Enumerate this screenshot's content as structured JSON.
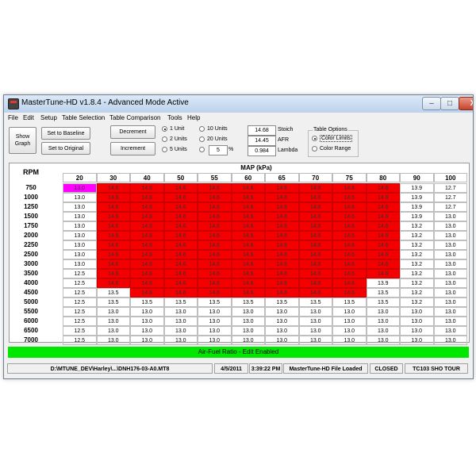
{
  "window": {
    "title": "MasterTune-HD  v1.8.4 - Advanced Mode Active",
    "controls": {
      "minimize": "–",
      "maximize": "□",
      "close": "X"
    }
  },
  "menu": [
    "File",
    "Edit",
    "Setup",
    "Table Selection",
    "Table Comparison",
    "Tools",
    "Help"
  ],
  "toolbar": {
    "show_graph_line1": "Show",
    "show_graph_line2": "Graph",
    "set_baseline": "Set to Baseline",
    "set_original": "Set to Original",
    "decrement": "Decrement",
    "increment": "Increment",
    "radios": {
      "one_unit": "1 Unit",
      "two_units": "2 Units",
      "five_units": "5 Units",
      "ten_units": "10 Units",
      "twenty_units": "20 Units"
    },
    "selected_unit": "1 Unit",
    "percent_value": "5",
    "percent_symbol": "%",
    "stoich_value": "14.68",
    "stoich_label": "Stoich",
    "afr_value": "14.45",
    "afr_label": "AFR",
    "lambda_value": "0.984",
    "lambda_label": "Lambda",
    "table_options": {
      "title": "Table Options",
      "color_limits": "Color Limits",
      "color_range": "Color Range",
      "selected": "Color Limits"
    }
  },
  "table": {
    "row_header": "RPM",
    "col_header": "MAP (kPa)",
    "columns": [
      "20",
      "30",
      "40",
      "50",
      "55",
      "60",
      "65",
      "70",
      "75",
      "80",
      "90",
      "100"
    ],
    "rows": [
      {
        "rpm": "750",
        "values": [
          "13.0",
          "14.6",
          "14.6",
          "14.6",
          "14.6",
          "14.6",
          "14.6",
          "14.6",
          "14.6",
          "14.6",
          "13.9",
          "12.7"
        ]
      },
      {
        "rpm": "1000",
        "values": [
          "13.0",
          "14.6",
          "14.6",
          "14.6",
          "14.6",
          "14.6",
          "14.6",
          "14.6",
          "14.6",
          "14.6",
          "13.9",
          "12.7"
        ]
      },
      {
        "rpm": "1250",
        "values": [
          "13.0",
          "14.6",
          "14.6",
          "14.6",
          "14.6",
          "14.6",
          "14.6",
          "14.6",
          "14.6",
          "14.6",
          "13.9",
          "12.7"
        ]
      },
      {
        "rpm": "1500",
        "values": [
          "13.0",
          "14.6",
          "14.6",
          "14.6",
          "14.6",
          "14.6",
          "14.6",
          "14.6",
          "14.6",
          "14.6",
          "13.9",
          "13.0"
        ]
      },
      {
        "rpm": "1750",
        "values": [
          "13.0",
          "14.6",
          "14.6",
          "14.6",
          "14.6",
          "14.6",
          "14.6",
          "14.6",
          "14.6",
          "14.6",
          "13.2",
          "13.0"
        ]
      },
      {
        "rpm": "2000",
        "values": [
          "13.0",
          "14.6",
          "14.6",
          "14.6",
          "14.6",
          "14.6",
          "14.6",
          "14.6",
          "14.6",
          "14.6",
          "13.2",
          "13.0"
        ]
      },
      {
        "rpm": "2250",
        "values": [
          "13.0",
          "14.6",
          "14.6",
          "14.6",
          "14.6",
          "14.6",
          "14.6",
          "14.6",
          "14.6",
          "14.6",
          "13.2",
          "13.0"
        ]
      },
      {
        "rpm": "2500",
        "values": [
          "13.0",
          "14.6",
          "14.6",
          "14.6",
          "14.6",
          "14.6",
          "14.6",
          "14.6",
          "14.6",
          "14.6",
          "13.2",
          "13.0"
        ]
      },
      {
        "rpm": "3000",
        "values": [
          "13.0",
          "14.6",
          "14.6",
          "14.6",
          "14.6",
          "14.6",
          "14.6",
          "14.6",
          "14.6",
          "14.6",
          "13.2",
          "13.0"
        ]
      },
      {
        "rpm": "3500",
        "values": [
          "12.5",
          "14.6",
          "14.6",
          "14.6",
          "14.6",
          "14.6",
          "14.6",
          "14.6",
          "14.6",
          "14.6",
          "13.2",
          "13.0"
        ]
      },
      {
        "rpm": "4000",
        "values": [
          "12.5",
          "14.6",
          "14.6",
          "14.6",
          "14.6",
          "14.6",
          "14.6",
          "14.6",
          "14.6",
          "13.9",
          "13.2",
          "13.0"
        ]
      },
      {
        "rpm": "4500",
        "values": [
          "12.5",
          "13.5",
          "14.6",
          "14.6",
          "14.6",
          "14.6",
          "14.6",
          "14.6",
          "14.6",
          "13.5",
          "13.2",
          "13.0"
        ]
      },
      {
        "rpm": "5000",
        "values": [
          "12.5",
          "13.5",
          "13.5",
          "13.5",
          "13.5",
          "13.5",
          "13.5",
          "13.5",
          "13.5",
          "13.5",
          "13.2",
          "13.0"
        ]
      },
      {
        "rpm": "5500",
        "values": [
          "12.5",
          "13.0",
          "13.0",
          "13.0",
          "13.0",
          "13.0",
          "13.0",
          "13.0",
          "13.0",
          "13.0",
          "13.0",
          "13.0"
        ]
      },
      {
        "rpm": "6000",
        "values": [
          "12.5",
          "13.0",
          "13.0",
          "13.0",
          "13.0",
          "13.0",
          "13.0",
          "13.0",
          "13.0",
          "13.0",
          "13.0",
          "13.0"
        ]
      },
      {
        "rpm": "6500",
        "values": [
          "12.5",
          "13.0",
          "13.0",
          "13.0",
          "13.0",
          "13.0",
          "13.0",
          "13.0",
          "13.0",
          "13.0",
          "13.0",
          "13.0"
        ]
      },
      {
        "rpm": "7000",
        "values": [
          "12.5",
          "13.0",
          "13.0",
          "13.0",
          "13.0",
          "13.0",
          "13.0",
          "13.0",
          "13.0",
          "13.0",
          "13.0",
          "13.0"
        ]
      }
    ],
    "highlight_color": "#f40000",
    "selected_cell_color": "#ff00ff",
    "color_limit_value": "14.6"
  },
  "status_banner": {
    "text": "Air-Fuel Ratio - Edit Enabled",
    "color": "#00e800"
  },
  "statusbar": {
    "file": "D:\\MTUNE_DEV\\Harley\\...\\DNH176-03-A0.MT8",
    "date": "4/5/2011",
    "time": "3:39:22 PM",
    "load_status": "MasterTune-HD File Loaded",
    "connection": "CLOSED",
    "vehicle": "TC103 SHO TOUR"
  }
}
